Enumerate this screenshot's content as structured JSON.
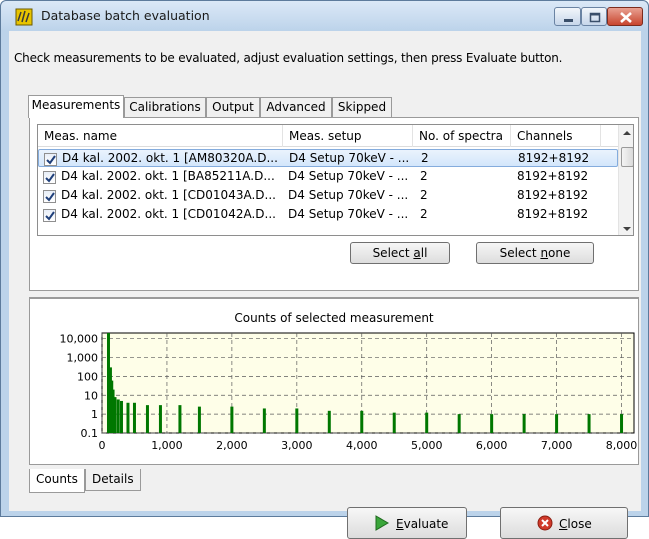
{
  "window": {
    "title": "Database batch evaluation"
  },
  "instructions": "Check measurements to be evaluated, adjust evaluation settings, then press Evaluate button.",
  "tabs": [
    {
      "label": "Measurements",
      "active": true
    },
    {
      "label": "Calibrations",
      "active": false
    },
    {
      "label": "Output",
      "active": false
    },
    {
      "label": "Advanced",
      "active": false
    },
    {
      "label": "Skipped",
      "active": false
    }
  ],
  "grid": {
    "columns": [
      "Meas. name",
      "Meas. setup",
      "No. of spectra",
      "Channels"
    ],
    "rows": [
      {
        "checked": true,
        "name": "D4 kal. 2002. okt. 1 [AM80320A.D...",
        "setup": "D4 Setup 70keV - ...",
        "spectra": "2",
        "channels": "8192+8192",
        "selected": true
      },
      {
        "checked": true,
        "name": "D4 kal. 2002. okt. 1 [BA85211A.D...",
        "setup": "D4 Setup 70keV - ...",
        "spectra": "2",
        "channels": "8192+8192",
        "selected": false
      },
      {
        "checked": true,
        "name": "D4 kal. 2002. okt. 1 [CD01043A.D...",
        "setup": "D4 Setup 70keV - ...",
        "spectra": "2",
        "channels": "8192+8192",
        "selected": false
      },
      {
        "checked": true,
        "name": "D4 kal. 2002. okt. 1 [CD01042A.D...",
        "setup": "D4 Setup 70keV - ...",
        "spectra": "2",
        "channels": "8192+8192",
        "selected": false
      }
    ]
  },
  "buttons": {
    "select_all_pre": "Select ",
    "select_all_u": "a",
    "select_all_post": "ll",
    "select_none_pre": "Select ",
    "select_none_u": "n",
    "select_none_post": "one",
    "evaluate_u": "E",
    "evaluate_post": "valuate",
    "close_u": "C",
    "close_post": "lose"
  },
  "chart_tabs": [
    {
      "label": "Counts",
      "active": true
    },
    {
      "label": "Details",
      "active": false
    }
  ],
  "colors": {
    "plot_bg": "#fefee8",
    "series": "#007700",
    "grid": "#5a5a5a"
  },
  "chart_data": {
    "type": "bar",
    "title": "Counts of selected measurement",
    "xlabel": "",
    "ylabel": "",
    "y_scale": "log",
    "xlim": [
      0,
      8192
    ],
    "ylim": [
      0.1,
      20000
    ],
    "x_ticks": [
      0,
      1000,
      2000,
      3000,
      4000,
      5000,
      6000,
      7000,
      8000
    ],
    "x_tick_labels": [
      "0",
      "1,000",
      "2,000",
      "3,000",
      "4,000",
      "5,000",
      "6,000",
      "7,000",
      "8,000"
    ],
    "y_ticks": [
      0.1,
      1,
      10,
      100,
      1000,
      10000
    ],
    "y_tick_labels": [
      "0.1",
      "1",
      "10",
      "100",
      "1,000",
      "10,000"
    ],
    "grid": true,
    "series": [
      {
        "x": [
          0,
          60,
          100,
          130,
          150,
          170,
          200,
          250,
          300,
          400,
          500,
          700,
          900,
          1200,
          1500,
          2000,
          2500,
          3000,
          3500,
          4000,
          4500,
          5000,
          5500,
          6000,
          6500,
          7000,
          7500,
          8000
        ],
        "values": [
          0.1,
          0.1,
          20000,
          300,
          60,
          20,
          8,
          6,
          5,
          4,
          4,
          3,
          3,
          3,
          2.5,
          2.5,
          2,
          2,
          1.5,
          1.5,
          1.2,
          1.2,
          1,
          1,
          1,
          1,
          1,
          1
        ]
      }
    ]
  }
}
